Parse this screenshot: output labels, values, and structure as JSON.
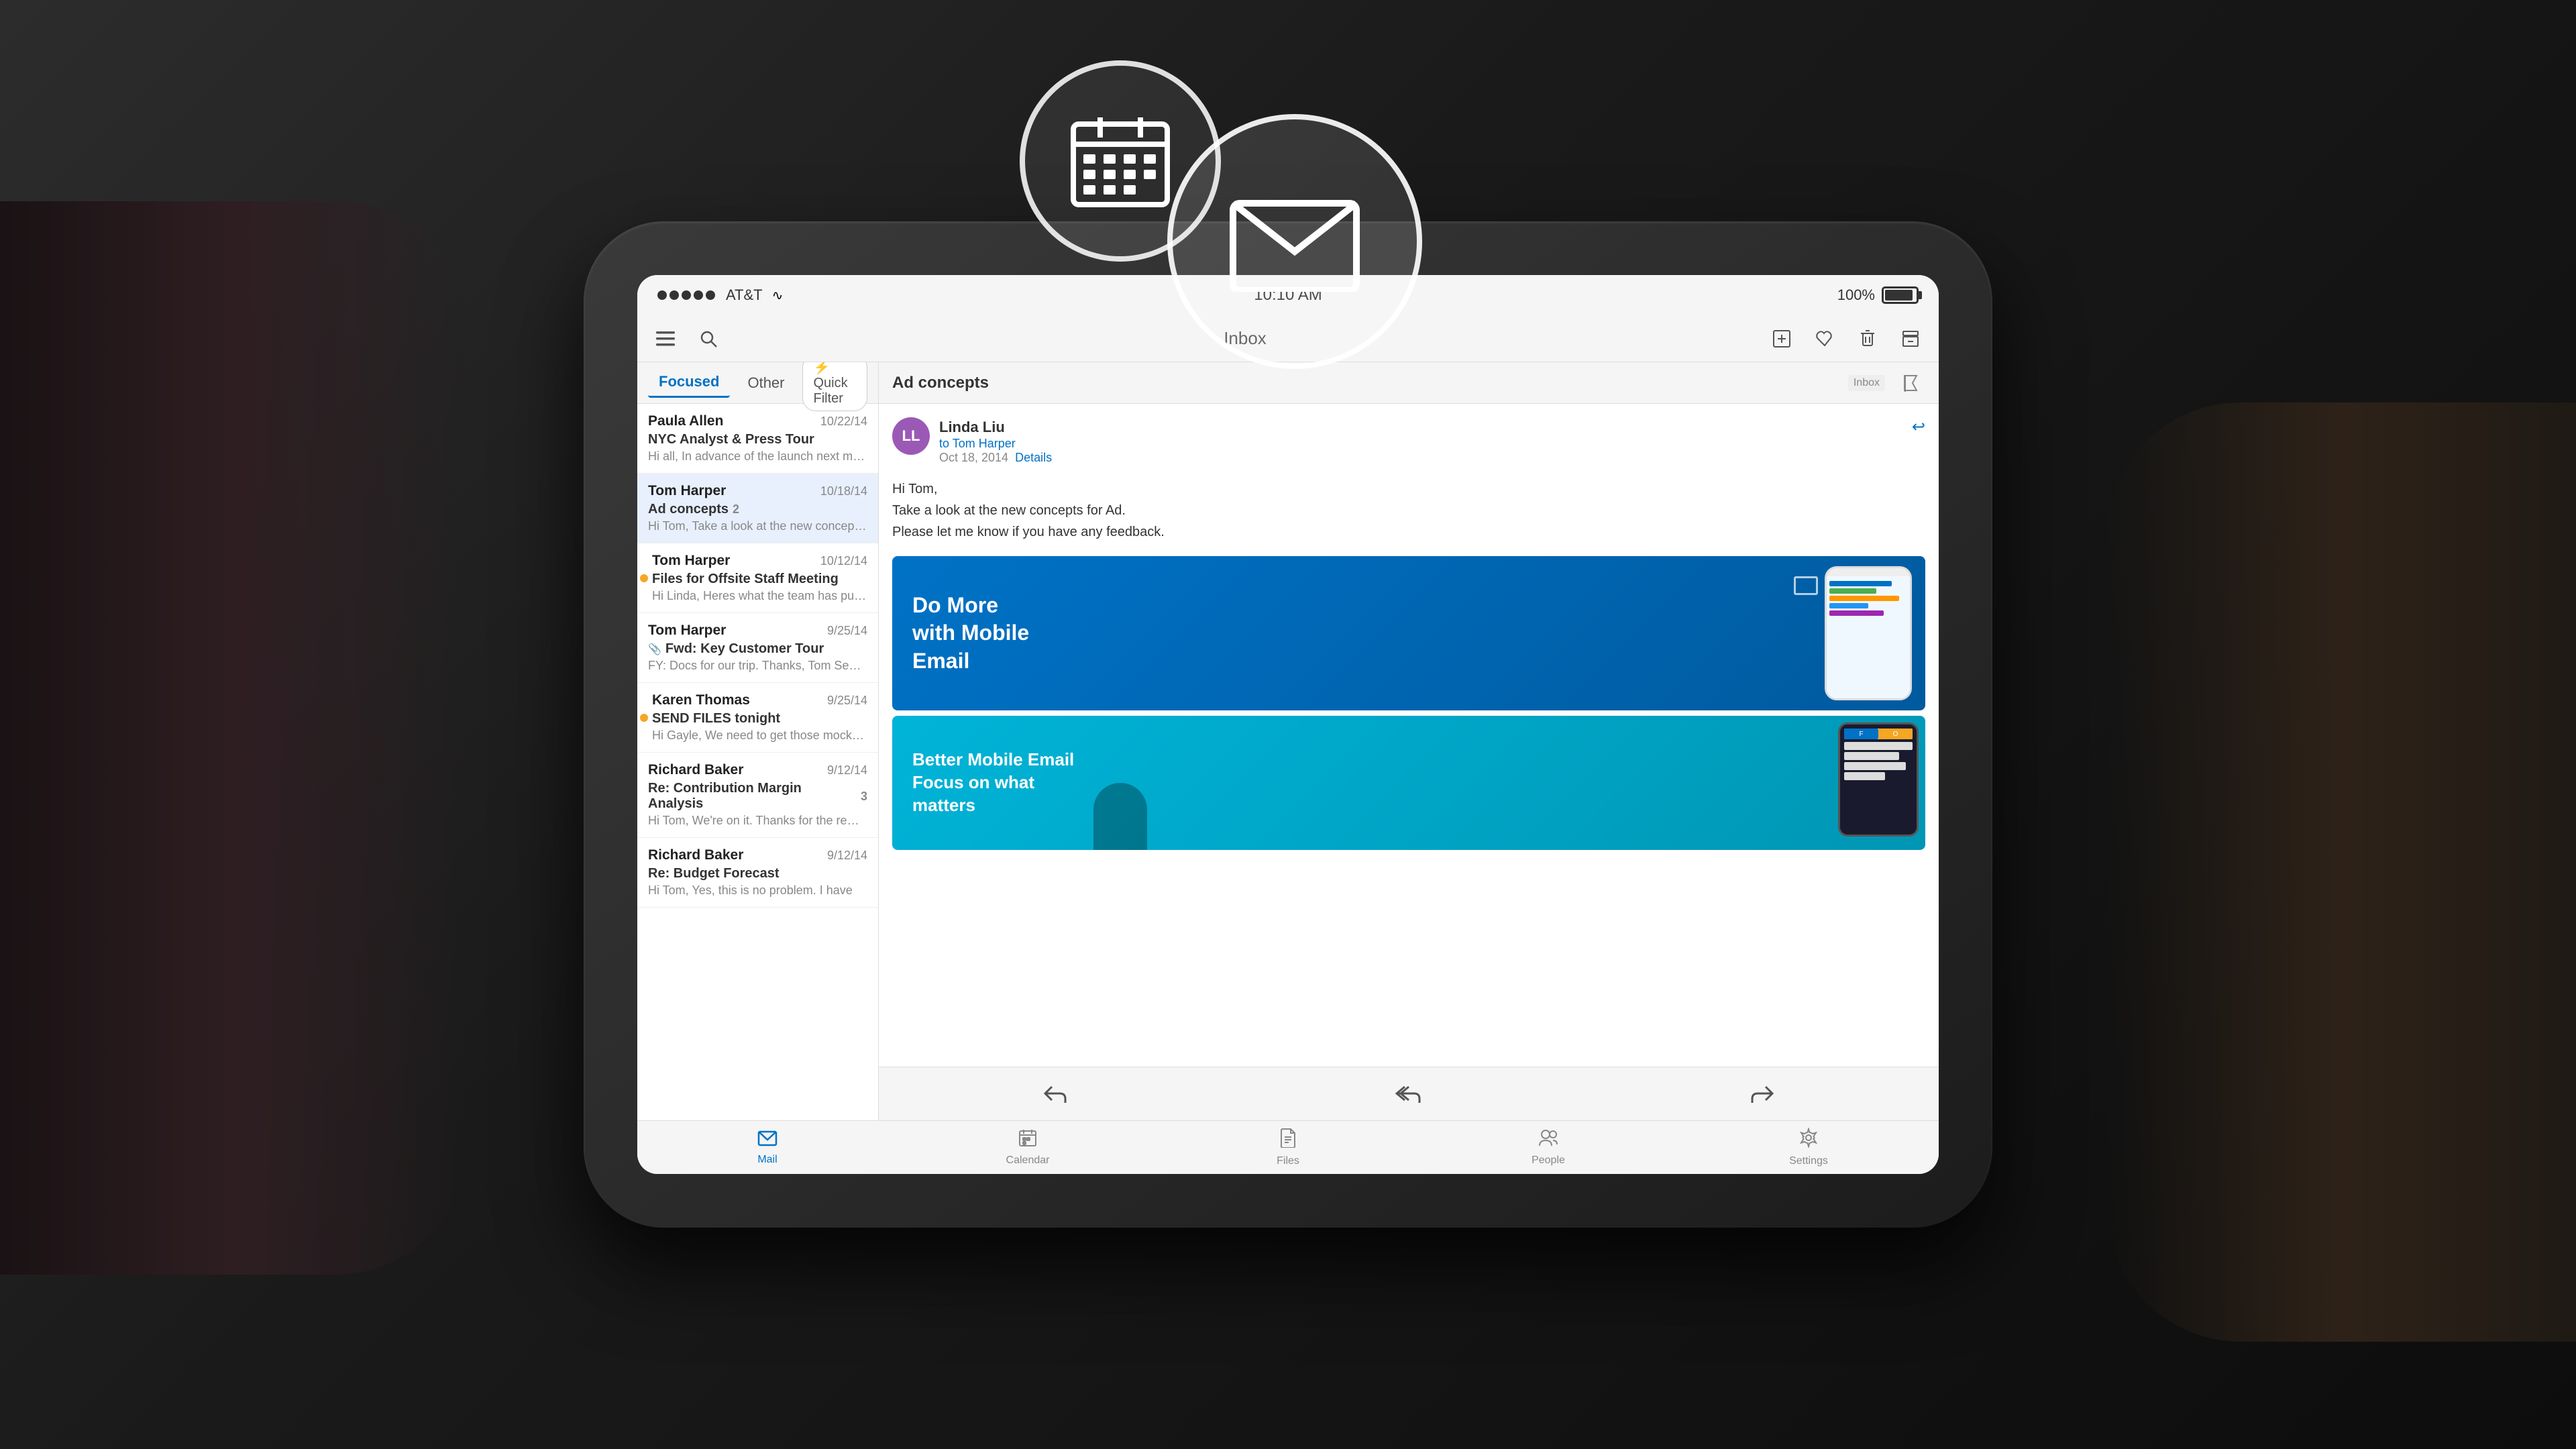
{
  "scene": {
    "bg_color": "#1a1a1a"
  },
  "floating_icons": {
    "calendar_circle": "calendar floating icon",
    "mail_circle": "mail floating icon"
  },
  "status_bar": {
    "signal_carrier": "AT&T",
    "wifi": "wifi",
    "time": "10:10 AM",
    "battery_percent": "100%"
  },
  "toolbar": {
    "inbox_label": "Inbox",
    "compose_icon": "compose",
    "menu_icon": "menu",
    "search_icon": "search",
    "flag_icon": "flag",
    "trash_icon": "trash",
    "archive_icon": "archive",
    "favorite_icon": "favorite"
  },
  "tabs": {
    "focused": "Focused",
    "other": "Other",
    "quick_filter": "⚡ Quick Filter"
  },
  "email_list": {
    "items": [
      {
        "sender": "Paula Allen",
        "date": "10/22/14",
        "subject": "NYC Analyst & Press Tour",
        "preview": "Hi all, In advance of the launch next month, a Tom and Linda will be",
        "indicator": "none",
        "attachment": false,
        "count": ""
      },
      {
        "sender": "Tom Harper",
        "date": "10/18/14",
        "subject": "Ad concepts",
        "preview": "Hi Tom, Take a look at the new concepts for Ad. Please let me know",
        "indicator": "none",
        "attachment": false,
        "count": "2"
      },
      {
        "sender": "Tom Harper",
        "date": "10/12/14",
        "subject": "Files for Offsite Staff Meeting",
        "preview": "Hi Linda, Heres what the team has pulled together so far. This will help",
        "indicator": "orange",
        "attachment": false,
        "count": ""
      },
      {
        "sender": "Tom Harper",
        "date": "9/25/14",
        "subject": "Fwd: Key Customer Tour",
        "preview": "FY: Docs for our trip. Thanks, Tom Sent from: Acmpli ----------",
        "indicator": "none",
        "attachment": true,
        "count": ""
      },
      {
        "sender": "Karen Thomas",
        "date": "9/25/14",
        "subject": "SEND FILES tonight",
        "preview": "Hi Gayle, We need to get those mockups to Hong Kong tonight, or",
        "indicator": "orange",
        "attachment": false,
        "count": ""
      },
      {
        "sender": "Richard Baker",
        "date": "9/12/14",
        "subject": "Re: Contribution Margin Analysis",
        "preview": "Hi Tom, We're on it. Thanks for the reminder. Something by end of next",
        "indicator": "none",
        "attachment": false,
        "count": "3"
      },
      {
        "sender": "Richard Baker",
        "date": "9/12/14",
        "subject": "Re: Budget Forecast",
        "preview": "Hi Tom, Yes, this is no problem. I have",
        "indicator": "none",
        "attachment": false,
        "count": ""
      }
    ]
  },
  "email_detail": {
    "subject": "Ad concepts",
    "inbox_tag": "Inbox",
    "sender": {
      "name": "Linda Liu",
      "initials": "LL",
      "avatar_color": "#9b59b6",
      "to": "to Tom Harper",
      "date": "Oct 18, 2014",
      "details_link": "Details"
    },
    "greeting": "Hi Tom,",
    "body_lines": [
      "Take a look at the new concepts for Ad.",
      "Please let me know if you have any feedback."
    ],
    "ad_image_1": {
      "text": "Do More with Mobile Email",
      "bg_color_start": "#0072C6",
      "bg_color_end": "#005a9e"
    },
    "ad_image_2": {
      "text_line1": "Better Mobile Email",
      "text_line2": "Focus on what matters",
      "bg_color_start": "#00b4d8",
      "bg_color_end": "#0096b4"
    }
  },
  "action_bar": {
    "reply_icon": "←",
    "reply_all_icon": "⇇",
    "forward_icon": "→"
  },
  "bottom_nav": {
    "items": [
      {
        "label": "Mail",
        "active": true,
        "icon": "✉"
      },
      {
        "label": "Calendar",
        "active": false,
        "icon": "📅"
      },
      {
        "label": "Files",
        "active": false,
        "icon": "📄"
      },
      {
        "label": "People",
        "active": false,
        "icon": "👤"
      },
      {
        "label": "Settings",
        "active": false,
        "icon": "⚙"
      }
    ]
  },
  "people_label": "People"
}
